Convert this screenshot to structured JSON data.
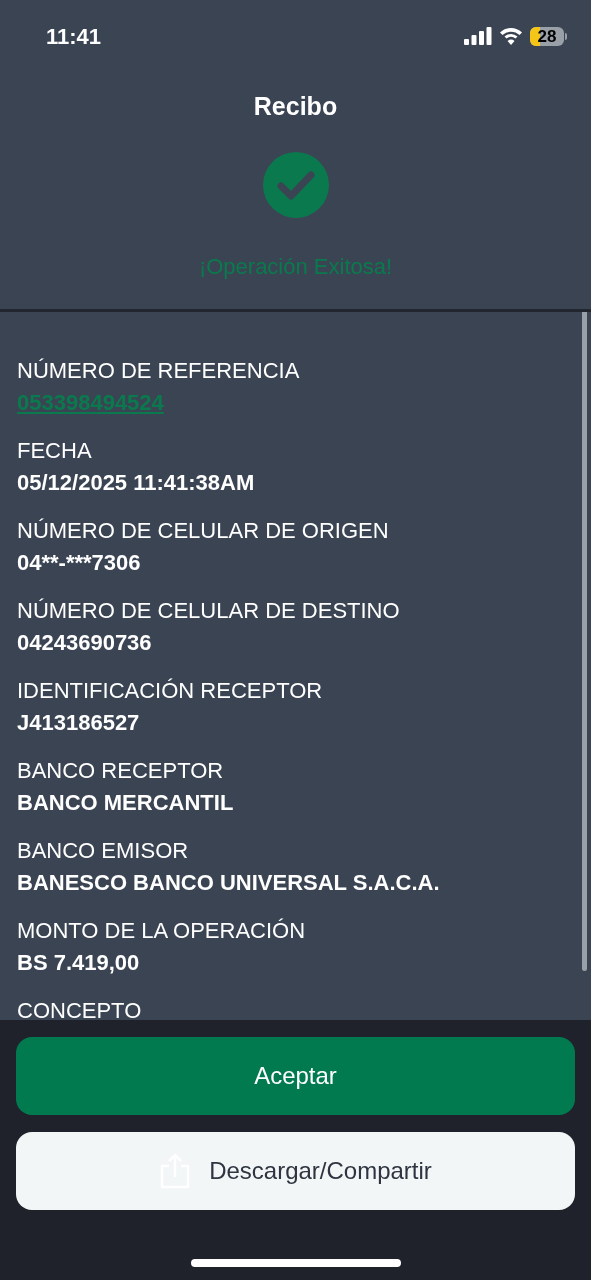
{
  "status_bar": {
    "time": "11:41",
    "battery": "28"
  },
  "header": {
    "title": "Recibo",
    "status_text": "¡Operación Exitosa!"
  },
  "fields": [
    {
      "label": "NÚMERO DE REFERENCIA",
      "value": "053398494524",
      "kind": "link"
    },
    {
      "label": "FECHA",
      "value": "05/12/2025 11:41:38AM",
      "kind": "text"
    },
    {
      "label": "NÚMERO DE CELULAR DE ORIGEN",
      "value": "04**-***7306",
      "kind": "text"
    },
    {
      "label": "NÚMERO DE CELULAR DE DESTINO",
      "value": "04243690736",
      "kind": "text"
    },
    {
      "label": "IDENTIFICACIÓN RECEPTOR",
      "value": "J413186527",
      "kind": "text"
    },
    {
      "label": "BANCO RECEPTOR",
      "value": "BANCO MERCANTIL",
      "kind": "text"
    },
    {
      "label": "BANCO EMISOR",
      "value": "BANESCO BANCO UNIVERSAL S.A.C.A.",
      "kind": "text"
    },
    {
      "label": "MONTO DE LA OPERACIÓN",
      "value": "BS 7.419,00",
      "kind": "text"
    },
    {
      "label": "CONCEPTO"
    }
  ],
  "buttons": [
    {
      "label": "Aceptar",
      "kind": "primary"
    },
    {
      "label": "Descargar/Compartir",
      "kind": "share"
    }
  ]
}
